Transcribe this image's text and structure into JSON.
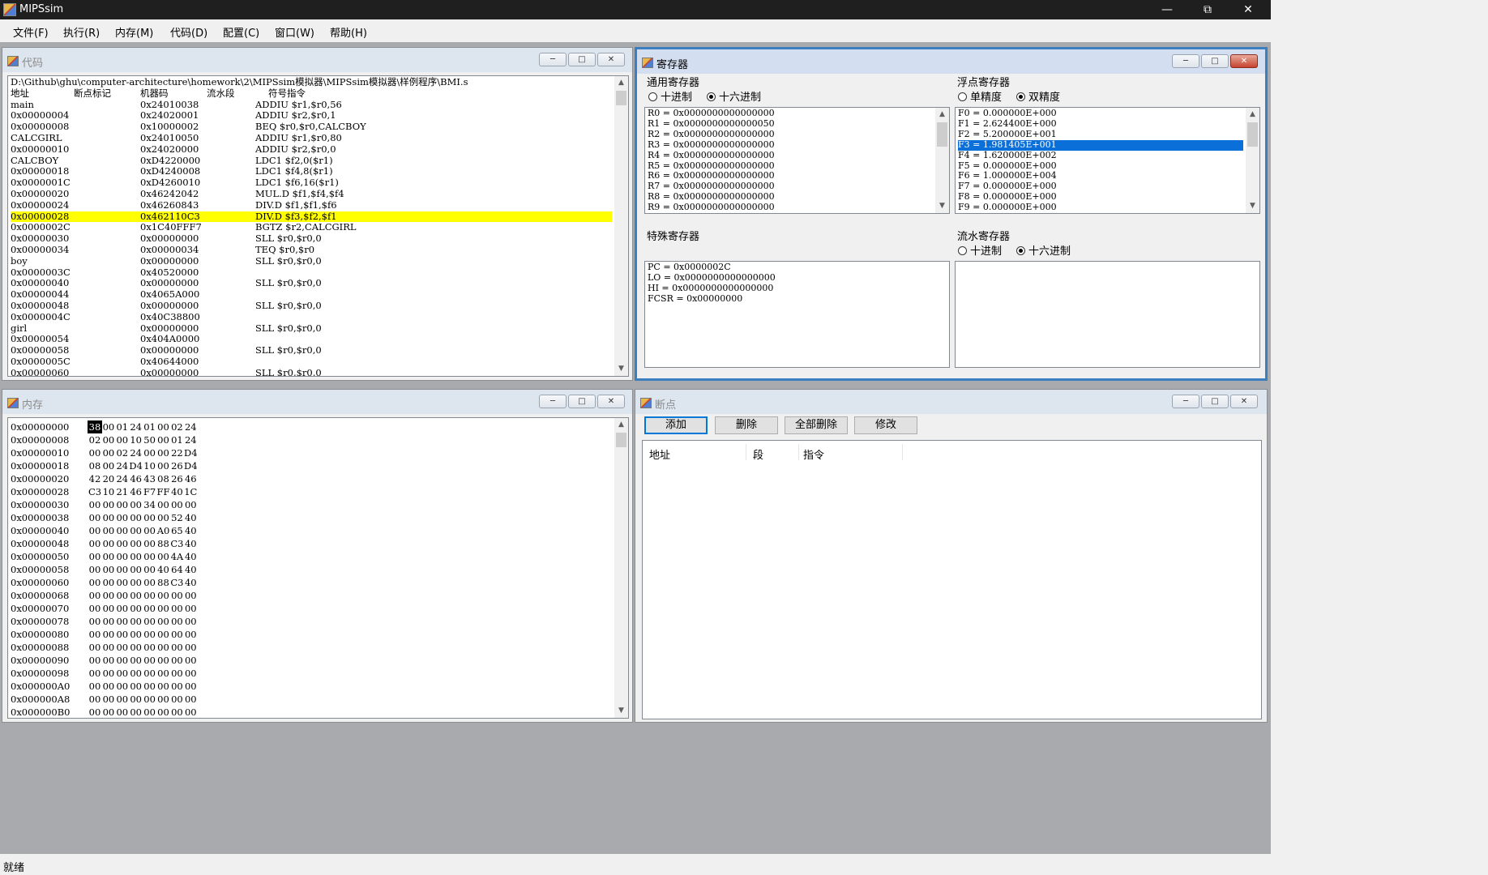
{
  "window": {
    "title": "MIPSsim"
  },
  "menu": [
    "文件(F)",
    "执行(R)",
    "内存(M)",
    "代码(D)",
    "配置(C)",
    "窗口(W)",
    "帮助(H)"
  ],
  "code": {
    "title": "代码",
    "path": "D:\\Github\\ghu\\computer-architecture\\homework\\2\\MIPSsim模拟器\\MIPSsim模拟器\\样例程序\\BMI.s",
    "headers": [
      "地址",
      "断点标记",
      "机器码",
      "流水段",
      "符号指令"
    ],
    "rows": [
      {
        "addr": "main",
        "code": "0x24010038",
        "ins": "ADDIU $r1,$r0,56"
      },
      {
        "addr": "0x00000004",
        "code": "0x24020001",
        "ins": "ADDIU $r2,$r0,1"
      },
      {
        "addr": "0x00000008",
        "code": "0x10000002",
        "ins": "BEQ $r0,$r0,CALCBOY"
      },
      {
        "addr": "CALCGIRL",
        "code": "0x24010050",
        "ins": "ADDIU $r1,$r0,80"
      },
      {
        "addr": "0x00000010",
        "code": "0x24020000",
        "ins": "ADDIU $r2,$r0,0"
      },
      {
        "addr": "CALCBOY",
        "code": "0xD4220000",
        "ins": "LDC1 $f2,0($r1)"
      },
      {
        "addr": "0x00000018",
        "code": "0xD4240008",
        "ins": "LDC1 $f4,8($r1)"
      },
      {
        "addr": "0x0000001C",
        "code": "0xD4260010",
        "ins": "LDC1 $f6,16($r1)"
      },
      {
        "addr": "0x00000020",
        "code": "0x46242042",
        "ins": "MUL.D $f1,$f4,$f4"
      },
      {
        "addr": "0x00000024",
        "code": "0x46260843",
        "ins": "DIV.D $f1,$f1,$f6"
      },
      {
        "addr": "0x00000028",
        "code": "0x462110C3",
        "ins": "DIV.D $f3,$f2,$f1",
        "highlight": true
      },
      {
        "addr": "0x0000002C",
        "code": "0x1C40FFF7",
        "ins": "BGTZ $r2,CALCGIRL"
      },
      {
        "addr": "0x00000030",
        "code": "0x00000000",
        "ins": "SLL $r0,$r0,0"
      },
      {
        "addr": "0x00000034",
        "code": "0x00000034",
        "ins": "TEQ $r0,$r0"
      },
      {
        "addr": "boy",
        "code": "0x00000000",
        "ins": "SLL $r0,$r0,0"
      },
      {
        "addr": "0x0000003C",
        "code": "0x40520000",
        "ins": ""
      },
      {
        "addr": "0x00000040",
        "code": "0x00000000",
        "ins": "SLL $r0,$r0,0"
      },
      {
        "addr": "0x00000044",
        "code": "0x4065A000",
        "ins": ""
      },
      {
        "addr": "0x00000048",
        "code": "0x00000000",
        "ins": "SLL $r0,$r0,0"
      },
      {
        "addr": "0x0000004C",
        "code": "0x40C38800",
        "ins": ""
      },
      {
        "addr": "girl",
        "code": "0x00000000",
        "ins": "SLL $r0,$r0,0"
      },
      {
        "addr": "0x00000054",
        "code": "0x404A0000",
        "ins": ""
      },
      {
        "addr": "0x00000058",
        "code": "0x00000000",
        "ins": "SLL $r0,$r0,0"
      },
      {
        "addr": "0x0000005C",
        "code": "0x40644000",
        "ins": ""
      },
      {
        "addr": "0x00000060",
        "code": "0x00000000",
        "ins": "SLL $r0,$r0,0"
      }
    ]
  },
  "registers": {
    "title": "寄存器",
    "gpr": {
      "label": "通用寄存器",
      "radio": [
        "十进制",
        "十六进制"
      ],
      "selected": 1,
      "rows": [
        "R0 = 0x0000000000000000",
        "R1 = 0x0000000000000050",
        "R2 = 0x0000000000000000",
        "R3 = 0x0000000000000000",
        "R4 = 0x0000000000000000",
        "R5 = 0x0000000000000000",
        "R6 = 0x0000000000000000",
        "R7 = 0x0000000000000000",
        "R8 = 0x0000000000000000",
        "R9 = 0x0000000000000000"
      ]
    },
    "fpr": {
      "label": "浮点寄存器",
      "radio": [
        "单精度",
        "双精度"
      ],
      "selected": 1,
      "selected_row": 3,
      "rows": [
        "F0 = 0.000000E+000",
        "F1 = 2.624400E+000",
        "F2 = 5.200000E+001",
        "F3 = 1.981405E+001",
        "F4 = 1.620000E+002",
        "F5 = 0.000000E+000",
        "F6 = 1.000000E+004",
        "F7 = 0.000000E+000",
        "F8 = 0.000000E+000",
        "F9 = 0.000000E+000"
      ]
    },
    "special": {
      "label": "特殊寄存器",
      "rows": [
        "PC = 0x0000002C",
        "LO = 0x0000000000000000",
        "HI = 0x0000000000000000",
        "FCSR = 0x00000000"
      ]
    },
    "pipeline": {
      "label": "流水寄存器",
      "radio": [
        "十进制",
        "十六进制"
      ],
      "selected": 1
    }
  },
  "memory": {
    "title": "内存",
    "selected_byte": 0,
    "rows": [
      {
        "addr": "0x00000000",
        "bytes": [
          "38",
          "00",
          "01",
          "24",
          "01",
          "00",
          "02",
          "24"
        ]
      },
      {
        "addr": "0x00000008",
        "bytes": [
          "02",
          "00",
          "00",
          "10",
          "50",
          "00",
          "01",
          "24"
        ]
      },
      {
        "addr": "0x00000010",
        "bytes": [
          "00",
          "00",
          "02",
          "24",
          "00",
          "00",
          "22",
          "D4"
        ]
      },
      {
        "addr": "0x00000018",
        "bytes": [
          "08",
          "00",
          "24",
          "D4",
          "10",
          "00",
          "26",
          "D4"
        ]
      },
      {
        "addr": "0x00000020",
        "bytes": [
          "42",
          "20",
          "24",
          "46",
          "43",
          "08",
          "26",
          "46"
        ]
      },
      {
        "addr": "0x00000028",
        "bytes": [
          "C3",
          "10",
          "21",
          "46",
          "F7",
          "FF",
          "40",
          "1C"
        ]
      },
      {
        "addr": "0x00000030",
        "bytes": [
          "00",
          "00",
          "00",
          "00",
          "34",
          "00",
          "00",
          "00"
        ]
      },
      {
        "addr": "0x00000038",
        "bytes": [
          "00",
          "00",
          "00",
          "00",
          "00",
          "00",
          "52",
          "40"
        ]
      },
      {
        "addr": "0x00000040",
        "bytes": [
          "00",
          "00",
          "00",
          "00",
          "00",
          "A0",
          "65",
          "40"
        ]
      },
      {
        "addr": "0x00000048",
        "bytes": [
          "00",
          "00",
          "00",
          "00",
          "00",
          "88",
          "C3",
          "40"
        ]
      },
      {
        "addr": "0x00000050",
        "bytes": [
          "00",
          "00",
          "00",
          "00",
          "00",
          "00",
          "4A",
          "40"
        ]
      },
      {
        "addr": "0x00000058",
        "bytes": [
          "00",
          "00",
          "00",
          "00",
          "00",
          "40",
          "64",
          "40"
        ]
      },
      {
        "addr": "0x00000060",
        "bytes": [
          "00",
          "00",
          "00",
          "00",
          "00",
          "88",
          "C3",
          "40"
        ]
      },
      {
        "addr": "0x00000068",
        "bytes": [
          "00",
          "00",
          "00",
          "00",
          "00",
          "00",
          "00",
          "00"
        ]
      },
      {
        "addr": "0x00000070",
        "bytes": [
          "00",
          "00",
          "00",
          "00",
          "00",
          "00",
          "00",
          "00"
        ]
      },
      {
        "addr": "0x00000078",
        "bytes": [
          "00",
          "00",
          "00",
          "00",
          "00",
          "00",
          "00",
          "00"
        ]
      },
      {
        "addr": "0x00000080",
        "bytes": [
          "00",
          "00",
          "00",
          "00",
          "00",
          "00",
          "00",
          "00"
        ]
      },
      {
        "addr": "0x00000088",
        "bytes": [
          "00",
          "00",
          "00",
          "00",
          "00",
          "00",
          "00",
          "00"
        ]
      },
      {
        "addr": "0x00000090",
        "bytes": [
          "00",
          "00",
          "00",
          "00",
          "00",
          "00",
          "00",
          "00"
        ]
      },
      {
        "addr": "0x00000098",
        "bytes": [
          "00",
          "00",
          "00",
          "00",
          "00",
          "00",
          "00",
          "00"
        ]
      },
      {
        "addr": "0x000000A0",
        "bytes": [
          "00",
          "00",
          "00",
          "00",
          "00",
          "00",
          "00",
          "00"
        ]
      },
      {
        "addr": "0x000000A8",
        "bytes": [
          "00",
          "00",
          "00",
          "00",
          "00",
          "00",
          "00",
          "00"
        ]
      },
      {
        "addr": "0x000000B0",
        "bytes": [
          "00",
          "00",
          "00",
          "00",
          "00",
          "00",
          "00",
          "00"
        ]
      }
    ]
  },
  "breakpoints": {
    "title": "断点",
    "buttons": [
      "添加",
      "删除",
      "全部删除",
      "修改"
    ],
    "headers": [
      "地址",
      "段",
      "指令"
    ]
  },
  "status": "就绪",
  "icons": {
    "minimize": "minimize-icon",
    "maximize": "maximize-icon",
    "close": "close-icon",
    "scroll_up": "chevron-up-icon",
    "scroll_down": "chevron-down-icon"
  }
}
